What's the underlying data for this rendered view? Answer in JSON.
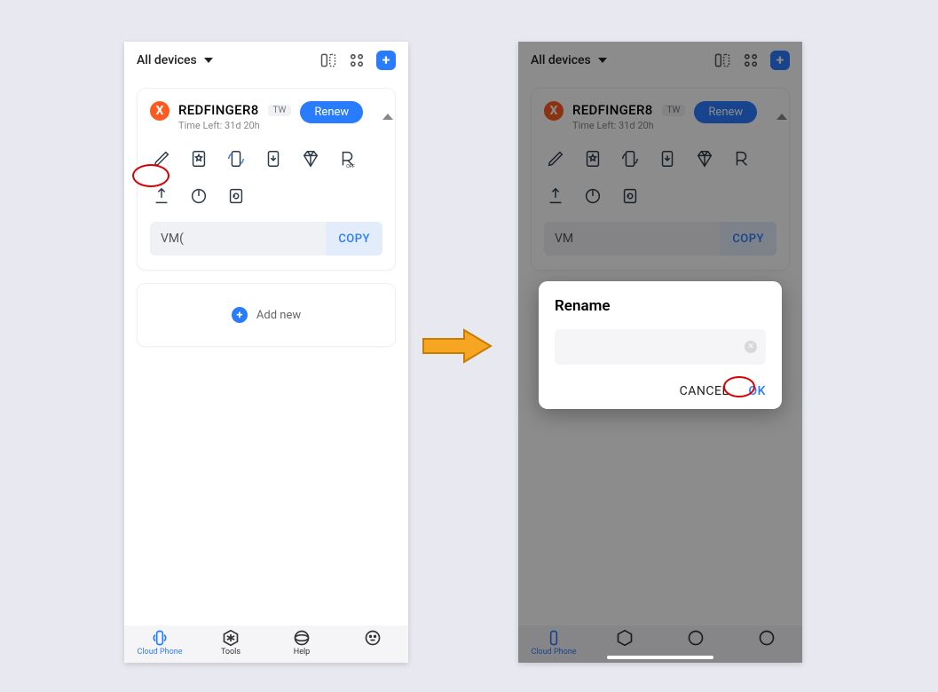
{
  "header": {
    "filter_label": "All devices"
  },
  "device": {
    "name": "REDFINGER8",
    "region_tag": "TW",
    "time_left": "Time Left: 31d 20h",
    "renew_label": "Renew",
    "vm_label_left": "VM(",
    "vm_label_right": "VM",
    "copy_label": "COPY"
  },
  "add_new_label": "Add new",
  "nav": {
    "cloud_phone": "Cloud Phone",
    "tools": "Tools",
    "help": "Help",
    "me": ""
  },
  "modal": {
    "title": "Rename",
    "cancel": "CANCEL",
    "ok": "OK"
  }
}
